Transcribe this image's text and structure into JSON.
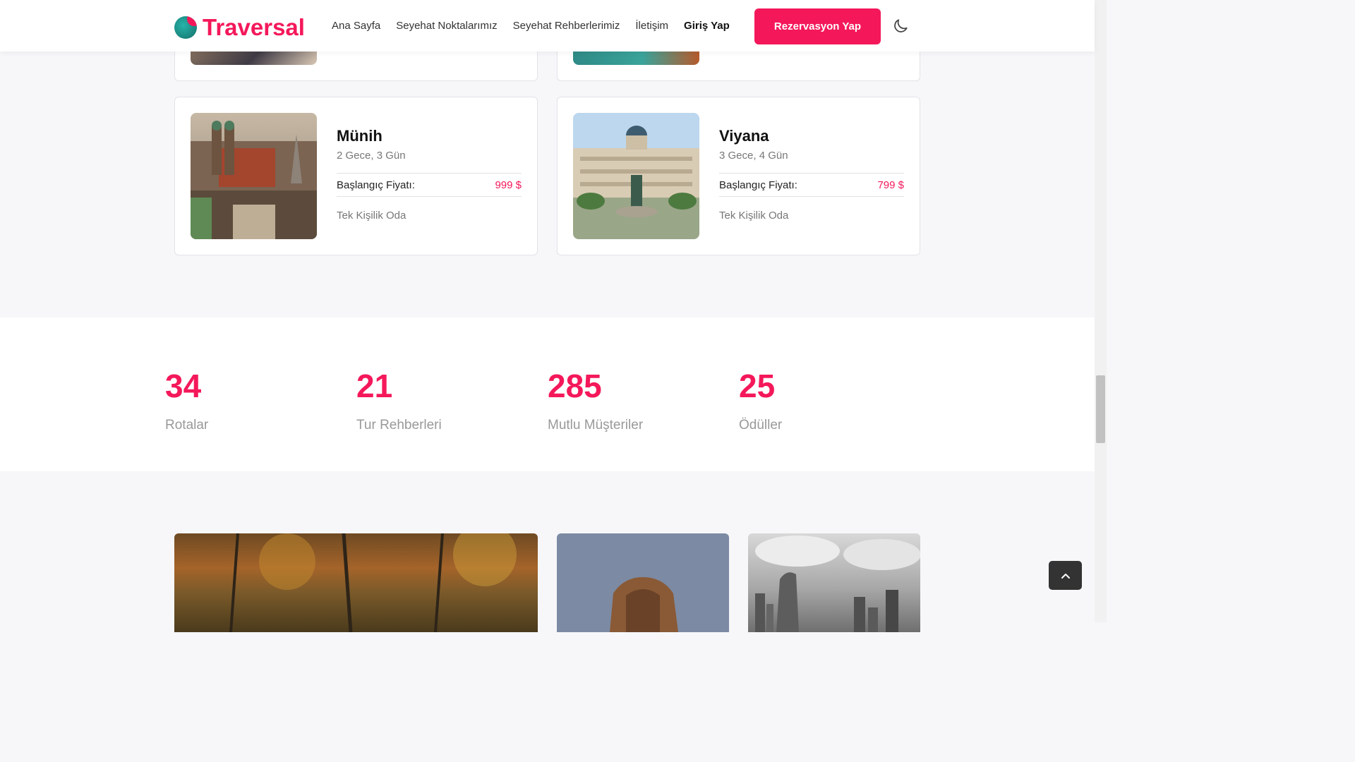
{
  "header": {
    "logo_text": "Traversal",
    "nav": [
      "Ana Sayfa",
      "Seyehat Noktalarımız",
      "Seyehat Rehberlerimiz",
      "İletişim",
      "Giriş Yap"
    ],
    "cta_label": "Rezervasyon Yap"
  },
  "tours": [
    {
      "city": "Münih",
      "duration": "2 Gece, 3 Gün",
      "price_label": "Başlangıç Fiyatı:",
      "price": "999 $",
      "room": "Tek Kişilik Oda"
    },
    {
      "city": "Viyana",
      "duration": "3 Gece, 4 Gün",
      "price_label": "Başlangıç Fiyatı:",
      "price": "799 $",
      "room": "Tek Kişilik Oda"
    }
  ],
  "stats": [
    {
      "value": "34",
      "label": "Rotalar"
    },
    {
      "value": "21",
      "label": "Tur Rehberleri"
    },
    {
      "value": "285",
      "label": "Mutlu Müşteriler"
    },
    {
      "value": "25",
      "label": "Ödüller"
    }
  ],
  "colors": {
    "accent": "#f4185a",
    "logo_teal": "#27b3a9"
  },
  "icons": {
    "theme_toggle": "moon-icon",
    "scroll_top": "chevron-up-icon"
  }
}
